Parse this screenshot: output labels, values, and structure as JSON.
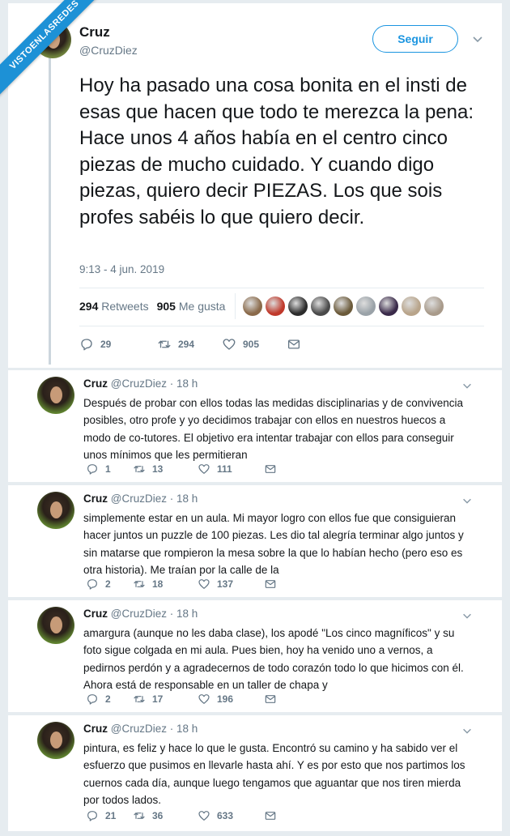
{
  "watermark": {
    "text": "VISTOENLASREDES",
    "color": "#1d91d6"
  },
  "colors": {
    "accent": "#1b95e0",
    "muted": "#657786",
    "text": "#14171a",
    "background": "#e6ecf0"
  },
  "main_tweet": {
    "name": "Cruz",
    "handle": "@CruzDiez",
    "follow_label": "Seguir",
    "text": "Hoy ha pasado una cosa bonita en el insti de esas que hacen que todo te merezca la pena: Hace unos 4 años había en el centro cinco piezas de mucho cuidado. Y cuando digo piezas, quiero decir PIEZAS. Los que sois profes sabéis lo que quiero decir.",
    "timestamp": "9:13 - 4 jun. 2019",
    "retweets_count": "294",
    "retweets_label": "Retweets",
    "likes_count": "905",
    "likes_label": "Me gusta",
    "likers": [
      "#8a6a4a",
      "#c0392b",
      "#2c2c2c",
      "#4a4a4a",
      "#6b5a3a",
      "#9aa2a8",
      "#3a2a4a",
      "#b8a48a",
      "#a89a8a"
    ],
    "actions": {
      "replies": "29",
      "retweets": "294",
      "likes": "905"
    }
  },
  "replies": [
    {
      "name": "Cruz",
      "handle": "@CruzDiez",
      "time": "18 h",
      "text": "Después de probar con ellos todas las medidas disciplinarias y de convivencia posibles, otro profe y yo decidimos trabajar con ellos en nuestros huecos a modo de co-tutores. El objetivo era intentar trabajar con ellos para conseguir unos mínimos que les permitieran",
      "replies": "1",
      "retweets": "13",
      "likes": "111"
    },
    {
      "name": "Cruz",
      "handle": "@CruzDiez",
      "time": "18 h",
      "text": "simplemente estar en un aula. Mi mayor logro con ellos fue que consiguieran hacer juntos un puzzle de 100 piezas. Les dio tal alegría terminar algo juntos y sin matarse que rompieron la mesa sobre la que lo habían hecho (pero eso es otra historia). Me traían por la calle de la",
      "replies": "2",
      "retweets": "18",
      "likes": "137"
    },
    {
      "name": "Cruz",
      "handle": "@CruzDiez",
      "time": "18 h",
      "text": "amargura (aunque no les daba clase), los apodé \"Los cinco magníficos\" y su foto sigue colgada en mi aula. Pues bien, hoy ha venido uno a vernos, a pedirnos perdón y a agradecernos de todo corazón todo lo que hicimos con él. Ahora está de responsable en un taller de chapa y",
      "replies": "2",
      "retweets": "17",
      "likes": "196"
    },
    {
      "name": "Cruz",
      "handle": "@CruzDiez",
      "time": "18 h",
      "text": "pintura, es feliz y hace lo que le gusta. Encontró su camino y ha sabido ver el esfuerzo que pusimos en llevarle hasta ahí. Y es por esto que nos partimos los cuernos cada día, aunque luego tengamos que aguantar que nos tiren mierda por todos lados.",
      "replies": "21",
      "retweets": "36",
      "likes": "633"
    }
  ]
}
